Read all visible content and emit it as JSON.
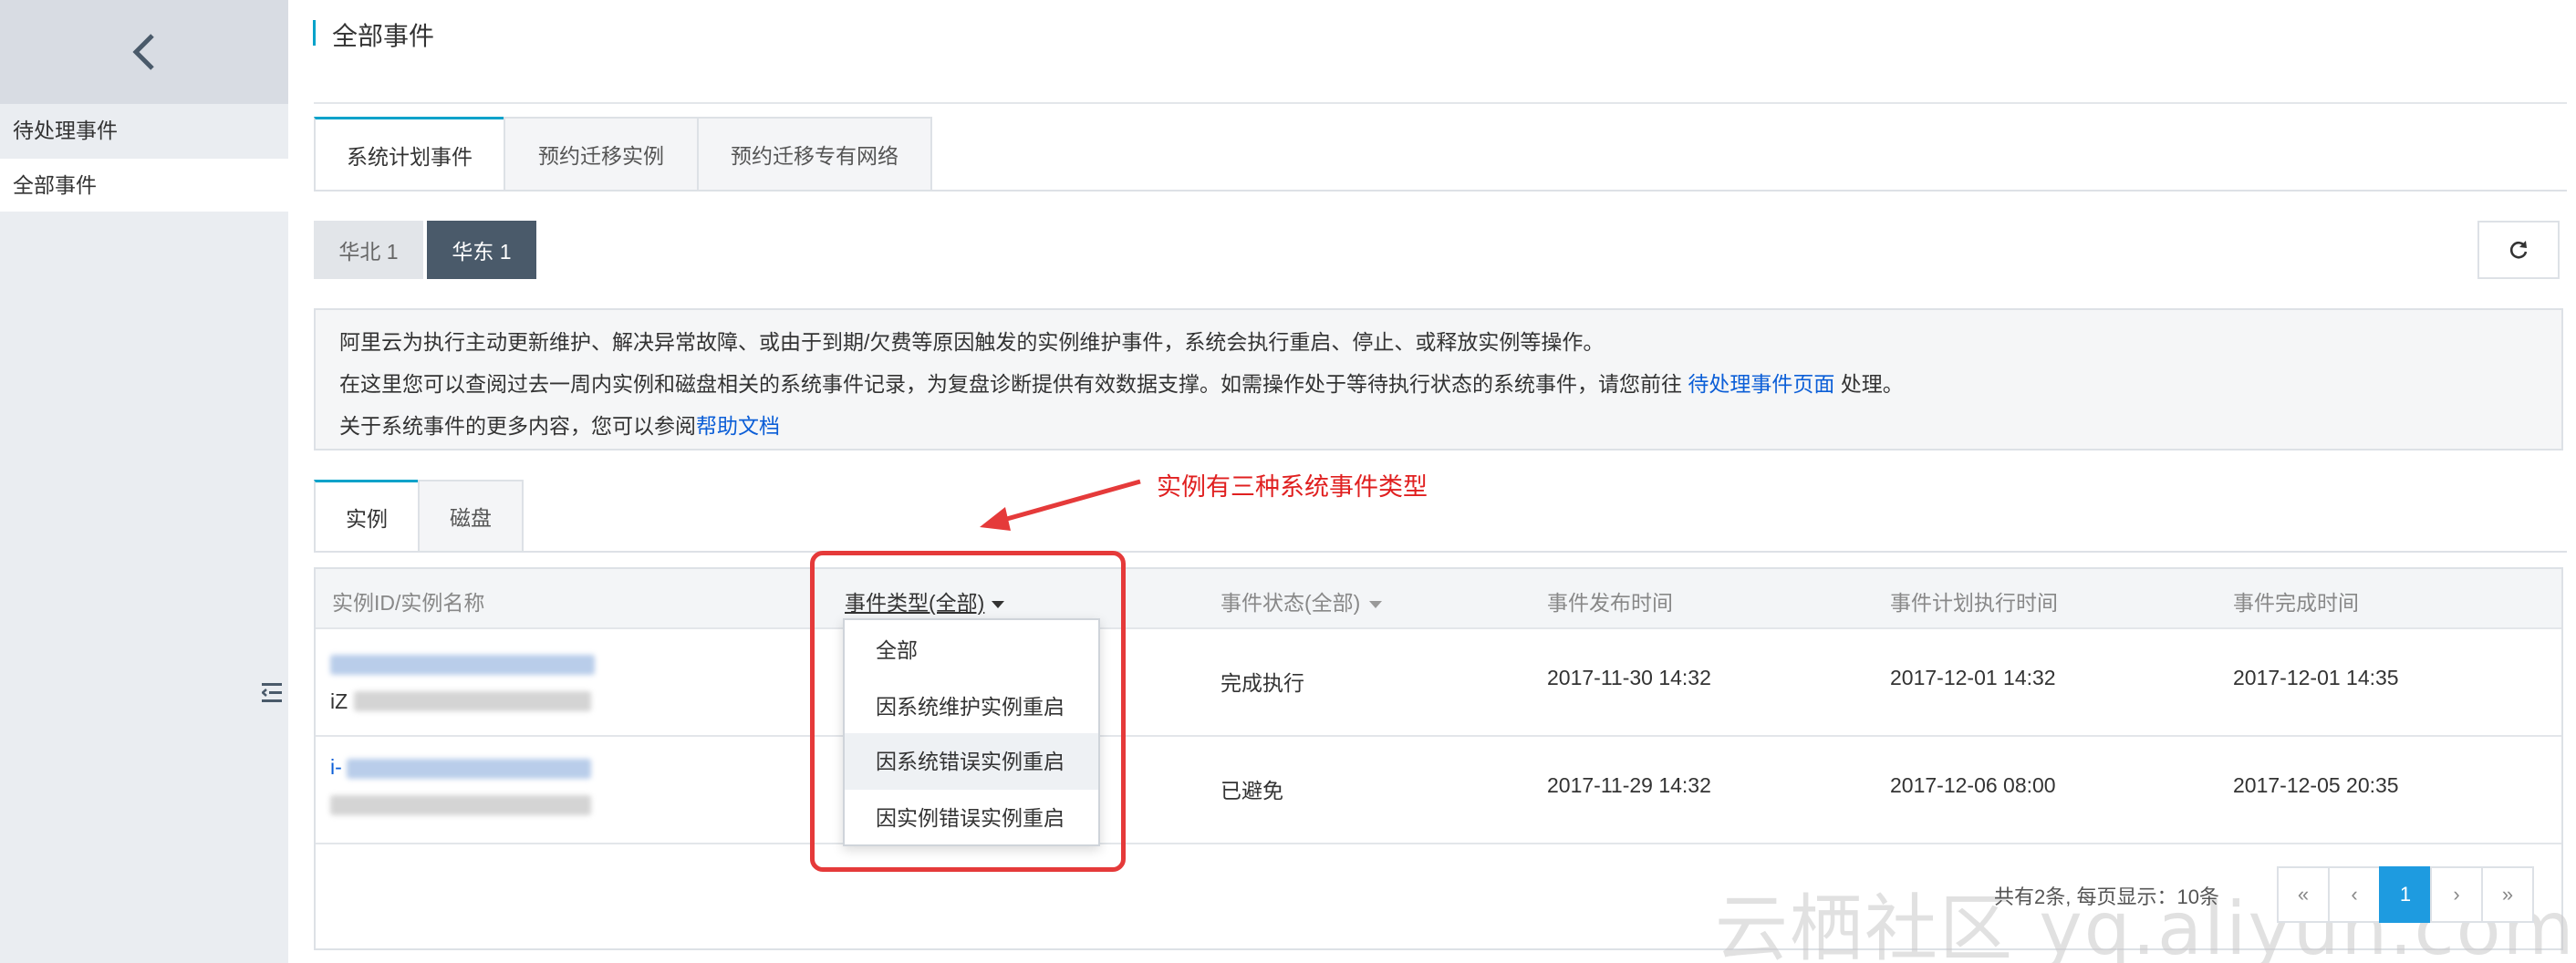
{
  "sidebar": {
    "items": [
      {
        "label": "待处理事件"
      },
      {
        "label": "全部事件"
      }
    ]
  },
  "page": {
    "title": "全部事件"
  },
  "tabs": [
    {
      "label": "系统计划事件"
    },
    {
      "label": "预约迁移实例"
    },
    {
      "label": "预约迁移专有网络"
    }
  ],
  "regions": [
    {
      "label": "华北 1"
    },
    {
      "label": "华东 1"
    }
  ],
  "notice": {
    "line1": "阿里云为执行主动更新维护、解决异常故障、或由于到期/欠费等原因触发的实例维护事件，系统会执行重启、停止、或释放实例等操作。",
    "line2_prefix": "在这里您可以查阅过去一周内实例和磁盘相关的系统事件记录，为复盘诊断提供有效数据支撑。如需操作处于等待执行状态的系统事件，请您前往 ",
    "line2_link": "待处理事件页面",
    "line2_suffix": " 处理。",
    "line3_prefix": "关于系统事件的更多内容，您可以参阅",
    "line3_link": "帮助文档"
  },
  "annotation": {
    "text": "实例有三种系统事件类型"
  },
  "subtabs": [
    {
      "label": "实例"
    },
    {
      "label": "磁盘"
    }
  ],
  "table": {
    "headers": {
      "instance": "实例ID/实例名称",
      "event_type": "事件类型(全部)",
      "event_status": "事件状态(全部)",
      "publish_time": "事件发布时间",
      "plan_time": "事件计划执行时间",
      "complete_time": "事件完成时间"
    },
    "rows": [
      {
        "id_prefix": "iZ",
        "status": "完成执行",
        "publish": "2017-11-30 14:32",
        "plan": "2017-12-01 14:32",
        "complete": "2017-12-01 14:35"
      },
      {
        "id_prefix": "i-",
        "status": "已避免",
        "publish": "2017-11-29 14:32",
        "plan": "2017-12-06 08:00",
        "complete": "2017-12-05 20:35"
      }
    ]
  },
  "dropdown": {
    "options": [
      {
        "label": "全部"
      },
      {
        "label": "因系统维护实例重启"
      },
      {
        "label": "因系统错误实例重启"
      },
      {
        "label": "因实例错误实例重启"
      }
    ]
  },
  "pagination": {
    "summary": "共有2条, 每页显示：10条",
    "first": "«",
    "prev": "‹",
    "current": "1",
    "next": "›",
    "last": "»"
  },
  "watermark": {
    "text": "云栖社区 yq.aliyun.com"
  }
}
